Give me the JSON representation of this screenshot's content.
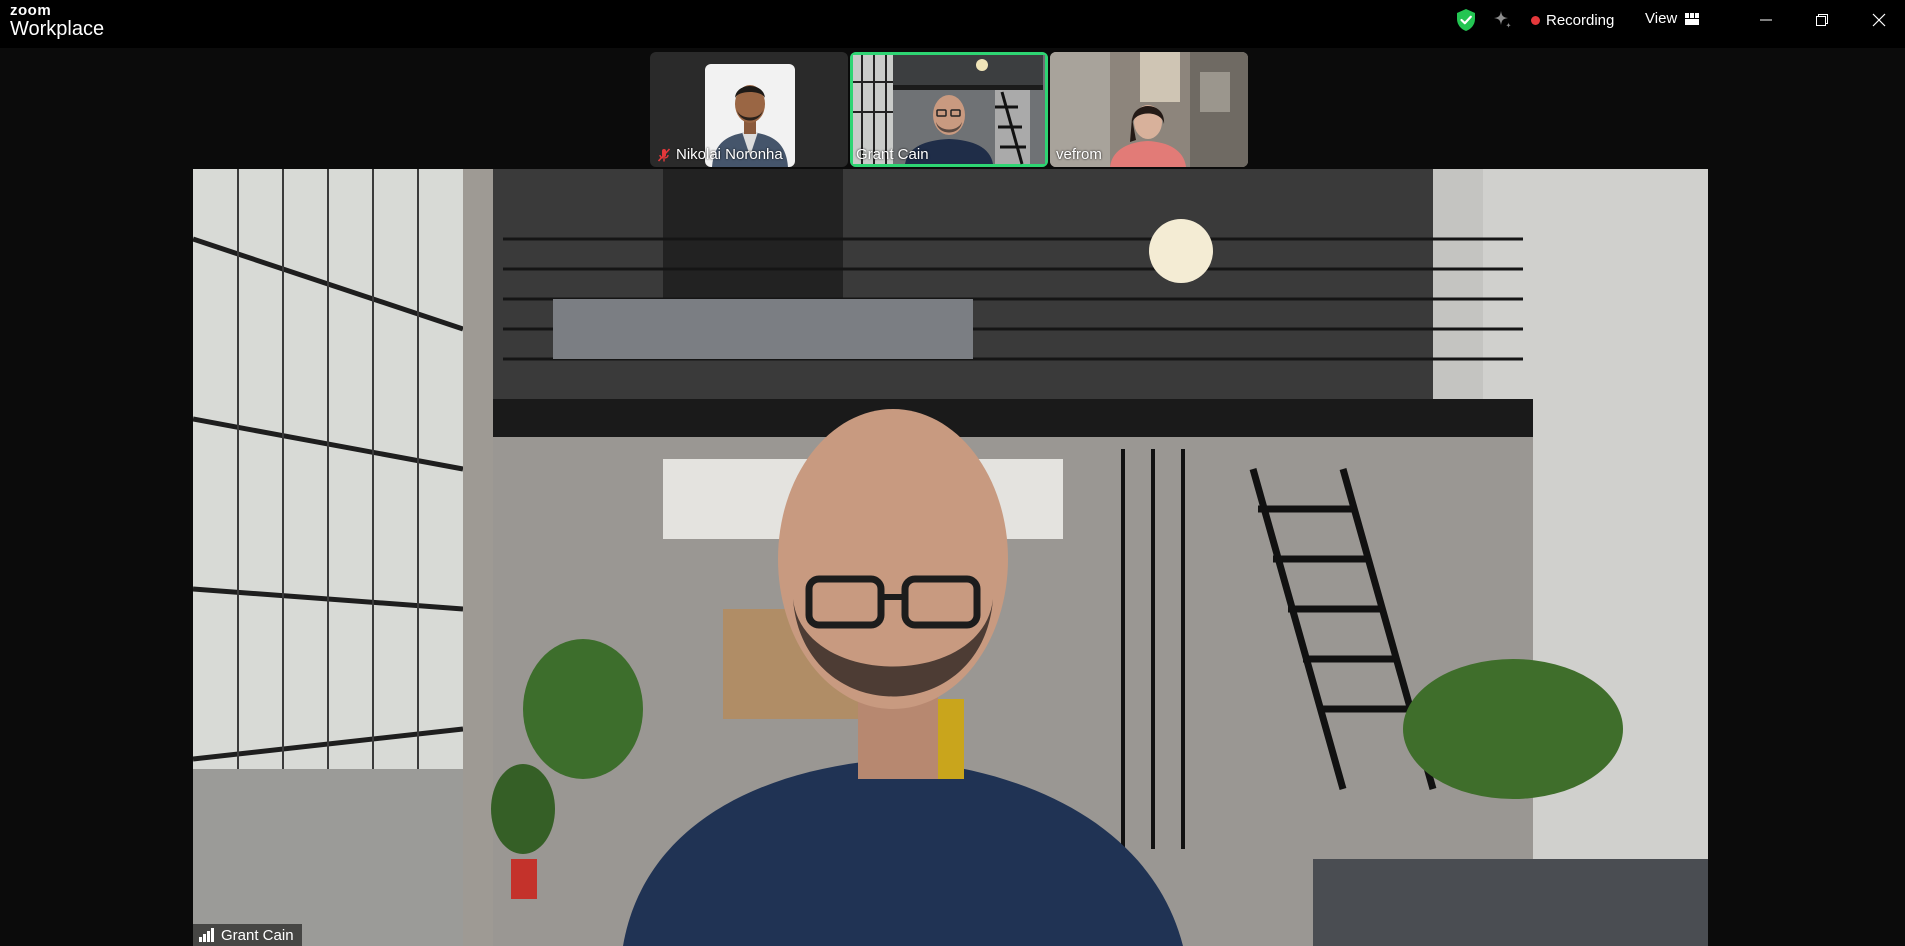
{
  "app": {
    "logo_top": "zoom",
    "logo_bottom": "Workplace"
  },
  "toolbar": {
    "security_icon": "green-shield-check-icon",
    "ai_icon": "sparkle-icon",
    "recording_label": "Recording",
    "view_label": "View",
    "recording_color": "#e5383b",
    "security_color": "#23c552"
  },
  "participants": [
    {
      "name": "Nikolai Noronha",
      "muted": true,
      "active_speaker": false
    },
    {
      "name": "Grant Cain",
      "muted": false,
      "active_speaker": true
    },
    {
      "name": "vefrom",
      "muted": false,
      "active_speaker": false
    }
  ],
  "main_video": {
    "speaker_name": "Grant Cain",
    "signal_icon": "signal-bars-icon"
  },
  "colors": {
    "active_speaker_border": "#2ed573",
    "background": "#0b0b0b"
  }
}
